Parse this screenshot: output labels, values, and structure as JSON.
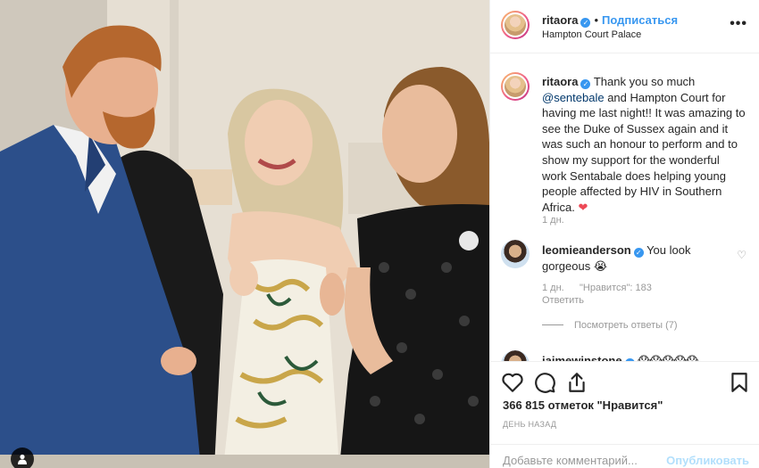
{
  "post": {
    "username": "ritaora",
    "follow_label": "Подписаться",
    "location": "Hampton Court Palace",
    "more_label": "•••"
  },
  "caption": {
    "username": "ritaora",
    "text_before": " Thank you so much ",
    "mention": "@sentebale",
    "text_after": " and Hampton Court for having me last night!! It was amazing to see the Duke of Sussex again and it was such an honour to perform and to show my support for the wonderful work Sentabale does helping young people affected by HIV in Southern Africa. ",
    "emoji": "❤",
    "age": "1 дн."
  },
  "comments": [
    {
      "username": "leomieanderson",
      "text": " You look gorgeous 😭",
      "age": "1 дн.",
      "likes": "\"Нравится\": 183",
      "reply_label": "Ответить",
      "view_replies": "Посмотреть ответы (7)"
    },
    {
      "username": "jaimewinstone",
      "text": " 😱😱😱😱😱"
    }
  ],
  "actions": {
    "like_icon": "heart-icon",
    "comment_icon": "comment-icon",
    "share_icon": "share-icon",
    "save_icon": "bookmark-icon"
  },
  "likes_label": "366 815 отметок \"Нравится\"",
  "timestamp": "ДЕНЬ НАЗАД",
  "add_comment": {
    "placeholder": "Добавьте комментарий...",
    "post_label": "Опубликовать"
  },
  "colors": {
    "link": "#3897f0",
    "verified": "#3897f0",
    "heart": "#ed4956",
    "muted": "#999999"
  }
}
